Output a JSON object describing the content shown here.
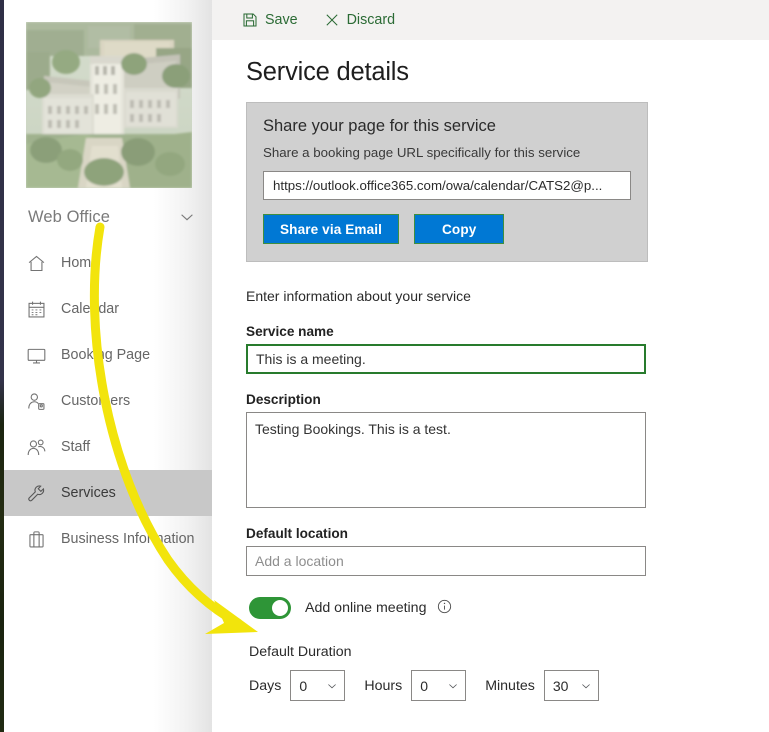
{
  "commandbar": {
    "save_label": "Save",
    "discard_label": "Discard"
  },
  "sidebar": {
    "org_name": "Web Office",
    "items": [
      {
        "label": "Home",
        "icon": "home-icon"
      },
      {
        "label": "Calendar",
        "icon": "calendar-icon"
      },
      {
        "label": "Booking Page",
        "icon": "monitor-icon"
      },
      {
        "label": "Customers",
        "icon": "person-badge-icon"
      },
      {
        "label": "Staff",
        "icon": "people-icon"
      },
      {
        "label": "Services",
        "icon": "wrench-icon"
      },
      {
        "label": "Business Information",
        "icon": "briefcase-icon"
      }
    ],
    "selected": "Services"
  },
  "main": {
    "page_title": "Service details",
    "share_panel": {
      "title": "Share your page for this service",
      "subtitle": "Share a booking page URL specifically for this service",
      "url_value": "https://outlook.office365.com/owa/calendar/CATS2@p...",
      "share_email_label": "Share via Email",
      "copy_label": "Copy"
    },
    "intro_line": "Enter information about your service",
    "service_name": {
      "label": "Service name",
      "value": "This is a meeting."
    },
    "description": {
      "label": "Description",
      "value": "Testing Bookings. This is a test."
    },
    "default_location": {
      "label": "Default location",
      "placeholder": "Add a location"
    },
    "online_meeting": {
      "label": "Add online meeting",
      "enabled": true
    },
    "default_duration": {
      "title": "Default Duration",
      "days_label": "Days",
      "days_value": "0",
      "hours_label": "Hours",
      "hours_value": "0",
      "minutes_label": "Minutes",
      "minutes_value": "30"
    }
  },
  "colors": {
    "accent_blue": "#0078d4",
    "toggle_green": "#2e9537",
    "command_green": "#2b6b35",
    "focus_green": "#287b2d",
    "annotation_yellow": "#f2e40c",
    "selected_nav": "#c8c8c8",
    "panel_gray": "#d0d0d0"
  }
}
